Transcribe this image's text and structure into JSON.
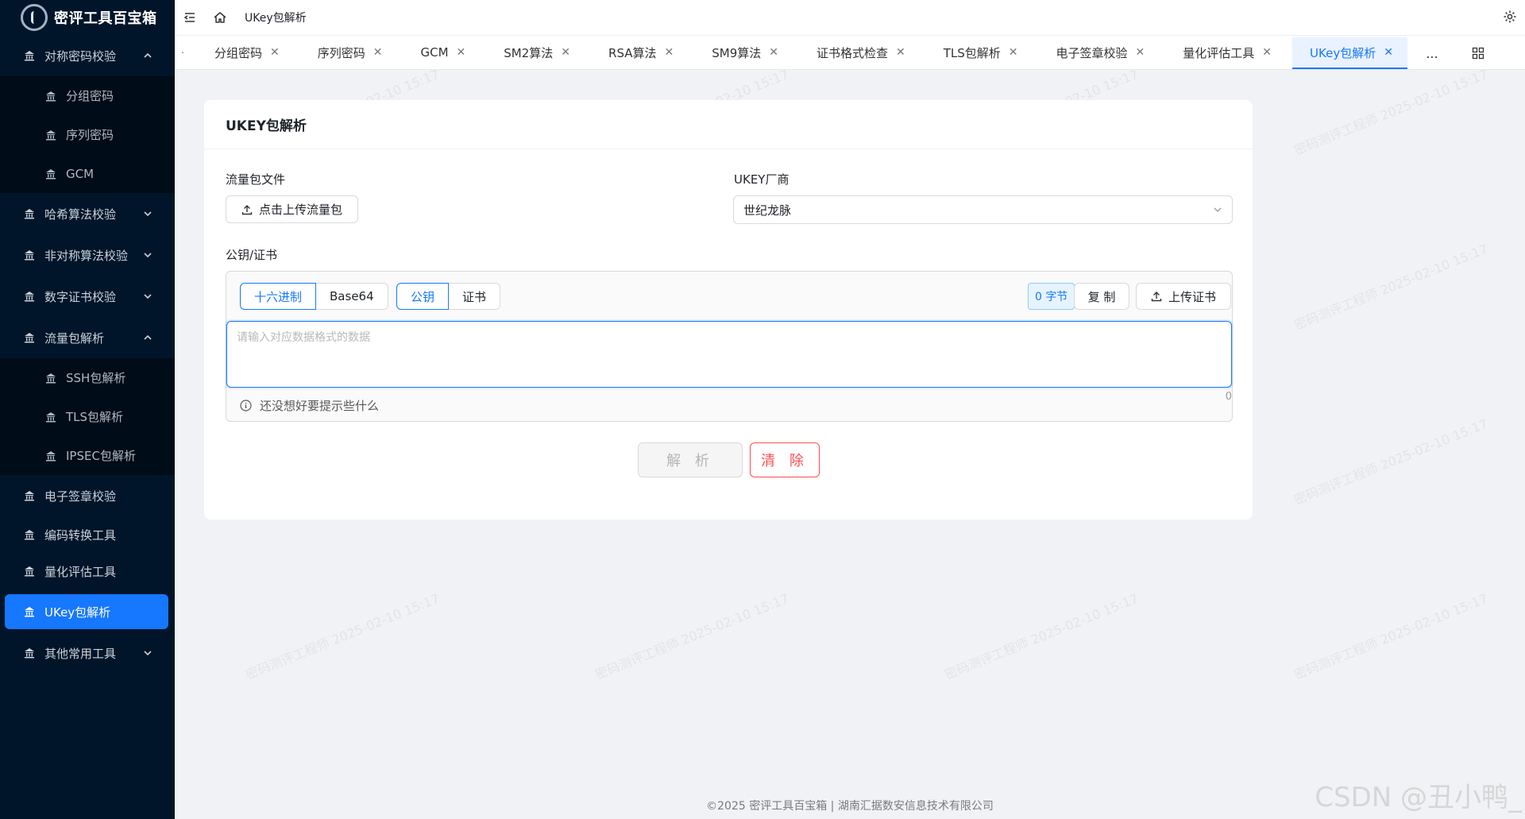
{
  "app": {
    "title": "密评工具百宝箱"
  },
  "sidebar": {
    "groups": [
      {
        "label": "对称密码校验",
        "expanded": true,
        "items": [
          "分组密码",
          "序列密码",
          "GCM"
        ]
      },
      {
        "label": "哈希算法校验",
        "expanded": false
      },
      {
        "label": "非对称算法校验",
        "expanded": false
      },
      {
        "label": "数字证书校验",
        "expanded": false
      },
      {
        "label": "流量包解析",
        "expanded": true,
        "items": [
          "SSH包解析",
          "TLS包解析",
          "IPSEC包解析"
        ]
      },
      {
        "label": "电子签章校验"
      },
      {
        "label": "编码转换工具"
      },
      {
        "label": "量化评估工具"
      },
      {
        "label": "UKey包解析",
        "active": true
      },
      {
        "label": "其他常用工具",
        "expanded": false
      }
    ]
  },
  "header": {
    "breadcrumb": "UKey包解析"
  },
  "tabs": [
    "分组密码",
    "序列密码",
    "GCM",
    "SM2算法",
    "RSA算法",
    "SM9算法",
    "证书格式检查",
    "TLS包解析",
    "电子签章校验",
    "量化评估工具",
    "UKey包解析"
  ],
  "tabs_active": "UKey包解析",
  "tabs_more": "...",
  "card": {
    "title": "UKEY包解析",
    "file_label": "流量包文件",
    "upload_button": "点击上传流量包",
    "vendor_label": "UKEY厂商",
    "vendor_value": "世纪龙脉",
    "key_label": "公钥/证书",
    "format_options": [
      "十六进制",
      "Base64"
    ],
    "format_selected": "十六进制",
    "type_options": [
      "公钥",
      "证书"
    ],
    "type_selected": "公钥",
    "bytes_badge": "0 字节",
    "copy_button": "复 制",
    "upload_cert_button": "上传证书",
    "textarea_placeholder": "请输入对应数据格式的数据",
    "char_count": "0",
    "hint": "还没想好要提示些什么",
    "parse_button": "解 析",
    "clear_button": "清 除"
  },
  "watermark": "密码测评工程师 2025-02-10 15:17",
  "footer": "©2025 密评工具百宝箱 | 湖南汇据数安信息技术有限公司",
  "corner_mark": "CSDN @丑小鸭_",
  "colors": {
    "sidebar_bg": "#001529",
    "accent": "#1677ff",
    "danger": "#ff4d4f"
  }
}
